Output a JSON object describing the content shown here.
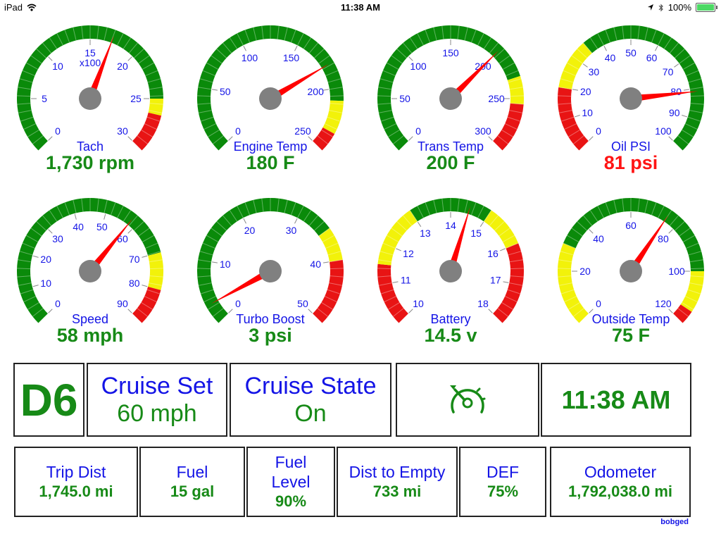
{
  "status_bar": {
    "device": "iPad",
    "time": "11:38 AM",
    "battery": "100%",
    "battery_level": 1.0,
    "icons": [
      "wifi-icon",
      "location-icon",
      "bluetooth-icon",
      "battery-icon"
    ]
  },
  "colors": {
    "green_zone": "#0a8a0a",
    "yellow_zone": "#f2f20a",
    "red_zone": "#e81414",
    "needle": "#ff0000",
    "hub": "#808080",
    "label_blue": "#1414e6",
    "value_green": "#178a17",
    "value_red": "#ff1414"
  },
  "gauges": [
    {
      "id": "tach",
      "title": "Tach",
      "value_text": "1,730 rpm",
      "value_color": "green",
      "min": 0,
      "max": 30,
      "reading": 17.3,
      "ticks": [
        "0",
        "5",
        "10",
        "15",
        "20",
        "25",
        "30"
      ],
      "unit_label": "x100",
      "zones": [
        {
          "from": 0,
          "to": 25,
          "color": "green"
        },
        {
          "from": 25,
          "to": 26.5,
          "color": "yellow"
        },
        {
          "from": 26.5,
          "to": 30,
          "color": "red"
        }
      ]
    },
    {
      "id": "engine-temp",
      "title": "Engine Temp",
      "value_text": "180 F",
      "value_color": "green",
      "min": 0,
      "max": 250,
      "reading": 180,
      "ticks": [
        "0",
        "50",
        "100",
        "150",
        "200",
        "250"
      ],
      "zones": [
        {
          "from": 0,
          "to": 210,
          "color": "green"
        },
        {
          "from": 210,
          "to": 235,
          "color": "yellow"
        },
        {
          "from": 235,
          "to": 250,
          "color": "red"
        }
      ]
    },
    {
      "id": "trans-temp",
      "title": "Trans Temp",
      "value_text": "200 F",
      "value_color": "green",
      "min": 0,
      "max": 300,
      "reading": 200,
      "ticks": [
        "0",
        "50",
        "100",
        "150",
        "200",
        "250",
        "300"
      ],
      "zones": [
        {
          "from": 0,
          "to": 230,
          "color": "green"
        },
        {
          "from": 230,
          "to": 255,
          "color": "yellow"
        },
        {
          "from": 255,
          "to": 300,
          "color": "red"
        }
      ]
    },
    {
      "id": "oil-psi",
      "title": "Oil PSI",
      "value_text": "81 psi",
      "value_color": "red",
      "min": 0,
      "max": 100,
      "reading": 81,
      "ticks": [
        "0",
        "10",
        "20",
        "30",
        "40",
        "50",
        "60",
        "70",
        "80",
        "90",
        "100"
      ],
      "zones": [
        {
          "from": 0,
          "to": 20,
          "color": "red"
        },
        {
          "from": 20,
          "to": 35,
          "color": "yellow"
        },
        {
          "from": 35,
          "to": 100,
          "color": "green"
        }
      ]
    },
    {
      "id": "speed",
      "title": "Speed",
      "value_text": "58 mph",
      "value_color": "green",
      "min": 0,
      "max": 90,
      "reading": 58,
      "ticks": [
        "0",
        "10",
        "20",
        "30",
        "40",
        "50",
        "60",
        "70",
        "80",
        "90"
      ],
      "zones": [
        {
          "from": 0,
          "to": 70,
          "color": "green"
        },
        {
          "from": 70,
          "to": 80,
          "color": "yellow"
        },
        {
          "from": 80,
          "to": 90,
          "color": "red"
        }
      ]
    },
    {
      "id": "turbo-boost",
      "title": "Turbo Boost",
      "value_text": "3 psi",
      "value_color": "green",
      "min": 0,
      "max": 50,
      "reading": 3,
      "ticks": [
        "0",
        "10",
        "20",
        "30",
        "40",
        "50"
      ],
      "zones": [
        {
          "from": 0,
          "to": 35,
          "color": "green"
        },
        {
          "from": 35,
          "to": 40,
          "color": "yellow"
        },
        {
          "from": 40,
          "to": 50,
          "color": "red"
        }
      ]
    },
    {
      "id": "battery",
      "title": "Battery",
      "value_text": "14.5 v",
      "value_color": "green",
      "min": 10,
      "max": 18,
      "reading": 14.5,
      "ticks": [
        "10",
        "11",
        "12",
        "13",
        "14",
        "15",
        "16",
        "17",
        "18"
      ],
      "zones": [
        {
          "from": 10,
          "to": 11.5,
          "color": "red"
        },
        {
          "from": 11.5,
          "to": 13,
          "color": "yellow"
        },
        {
          "from": 13,
          "to": 15,
          "color": "green"
        },
        {
          "from": 15,
          "to": 16,
          "color": "yellow"
        },
        {
          "from": 16,
          "to": 18,
          "color": "red"
        }
      ]
    },
    {
      "id": "outside-temp",
      "title": "Outside Temp",
      "value_text": "75 F",
      "value_color": "green",
      "min": 0,
      "max": 120,
      "reading": 75,
      "ticks": [
        "0",
        "20",
        "40",
        "60",
        "80",
        "100",
        "120"
      ],
      "zones": [
        {
          "from": 0,
          "to": 30,
          "color": "yellow"
        },
        {
          "from": 30,
          "to": 100,
          "color": "green"
        },
        {
          "from": 100,
          "to": 115,
          "color": "yellow"
        },
        {
          "from": 115,
          "to": 120,
          "color": "red"
        }
      ]
    }
  ],
  "info_row1": {
    "gear": "D6",
    "cruise_set_label": "Cruise Set",
    "cruise_set_value": "60 mph",
    "cruise_state_label": "Cruise State",
    "cruise_state_value": "On",
    "cruise_icon": "cruise-control-icon",
    "clock": "11:38 AM"
  },
  "info_row2": [
    {
      "id": "trip-dist",
      "label": "Trip Dist",
      "value": "1,745.0 mi"
    },
    {
      "id": "fuel",
      "label": "Fuel",
      "value": "15 gal"
    },
    {
      "id": "fuel-level",
      "label": "Fuel Level",
      "value": "90%"
    },
    {
      "id": "dist-to-empty",
      "label": "Dist to Empty",
      "value": "733 mi"
    },
    {
      "id": "def",
      "label": "DEF",
      "value": "75%"
    },
    {
      "id": "odometer",
      "label": "Odometer",
      "value": "1,792,038.0 mi"
    }
  ],
  "credit": "bobged"
}
